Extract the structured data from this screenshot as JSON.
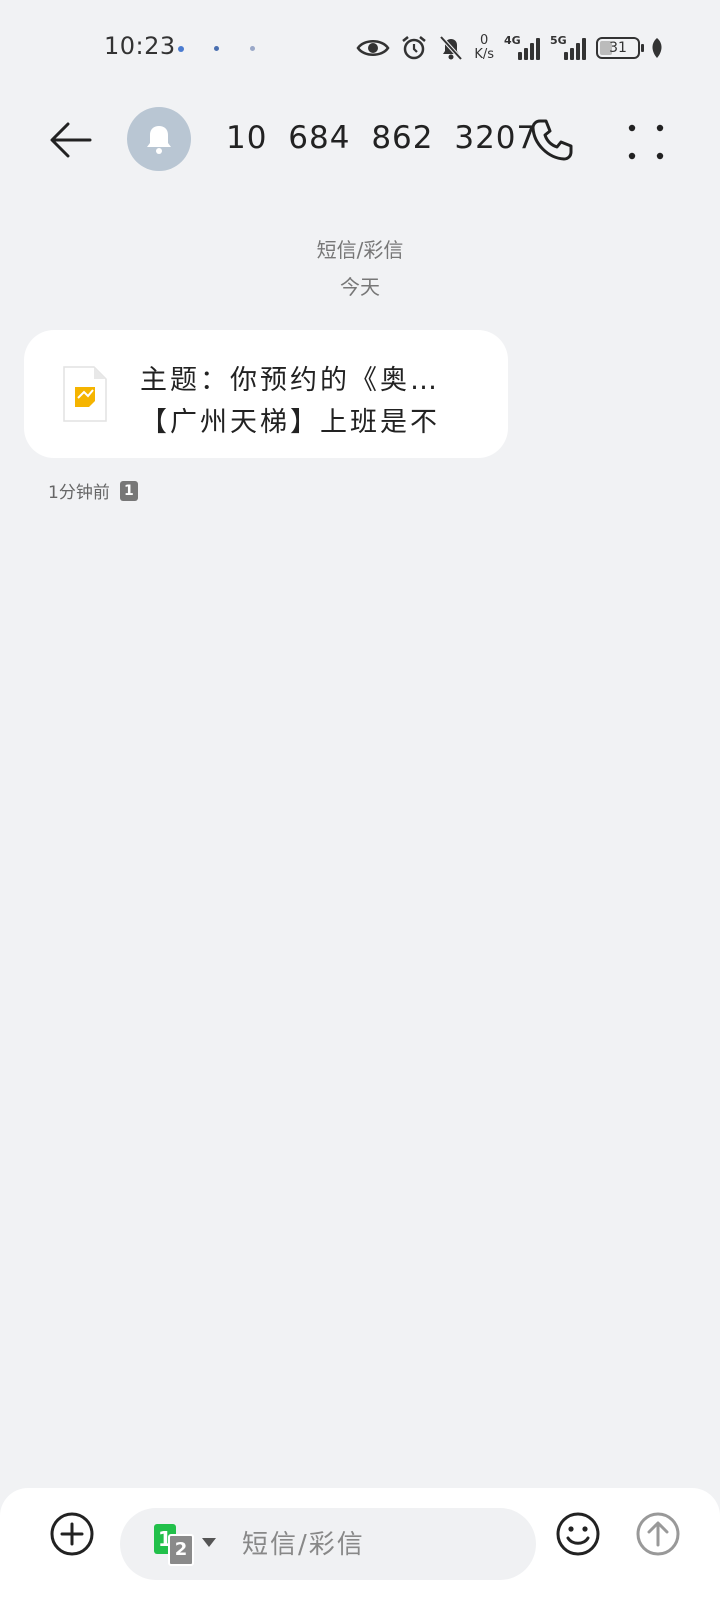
{
  "status_bar": {
    "time": "10:23",
    "net_speed_value": "0",
    "net_speed_unit": "K/s",
    "signal_1_label": "4G",
    "signal_2_label": "5G",
    "battery": "31"
  },
  "header": {
    "contact_number": "10 684 862 3207"
  },
  "conversation": {
    "message_type": "短信/彩信",
    "date_separator": "今天",
    "message": {
      "line1": "主题：你预约的《奥…",
      "line2": "【广州天梯】上班是不",
      "time": "1分钟前",
      "sim": "1"
    }
  },
  "composer": {
    "sim_primary": "1",
    "sim_secondary": "2",
    "placeholder": "短信/彩信"
  },
  "colors": {
    "background": "#f1f2f4",
    "avatar": "#b9c6d3",
    "sim1_green": "#22c04a",
    "file_icon_yellow": "#f5b400"
  }
}
